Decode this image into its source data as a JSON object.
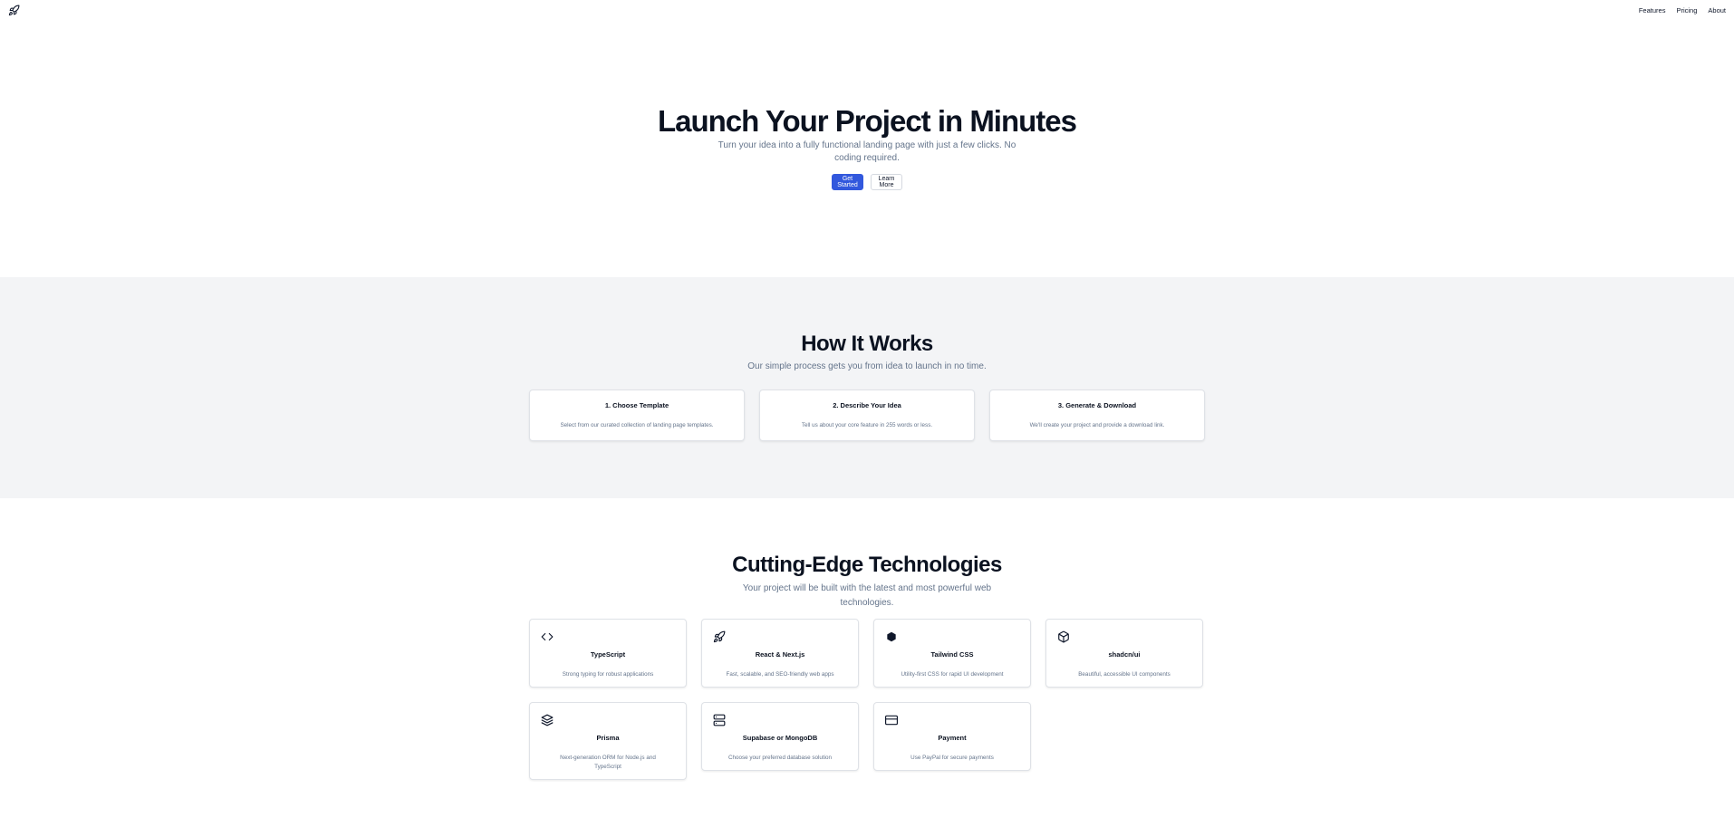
{
  "header": {
    "logo_icon": "rocket-icon",
    "nav": [
      "Features",
      "Pricing",
      "About"
    ]
  },
  "hero": {
    "title": "Launch Your Project in Minutes",
    "subtitle": "Turn your idea into a fully functional landing page with just a few clicks. No coding required.",
    "primary_button": "Get Started",
    "secondary_button": "Learn More"
  },
  "how": {
    "title": "How It Works",
    "subtitle": "Our simple process gets you from idea to launch in no time.",
    "steps": [
      {
        "title": "1. Choose Template",
        "desc": "Select from our curated collection of landing page templates."
      },
      {
        "title": "2. Describe Your Idea",
        "desc": "Tell us about your core feature in 255 words or less."
      },
      {
        "title": "3. Generate & Download",
        "desc": "We'll create your project and provide a download link."
      }
    ]
  },
  "tech": {
    "title": "Cutting-Edge Technologies",
    "subtitle": "Your project will be built with the latest and most powerful web technologies.",
    "items": [
      {
        "icon": "code-icon",
        "title": "TypeScript",
        "desc": "Strong typing for robust applications"
      },
      {
        "icon": "rocket-icon",
        "title": "React & Next.js",
        "desc": "Fast, scalable, and SEO-friendly web apps"
      },
      {
        "icon": "hexagon-icon",
        "title": "Tailwind CSS",
        "desc": "Utility-first CSS for rapid UI development"
      },
      {
        "icon": "box-icon",
        "title": "shadcn/ui",
        "desc": "Beautiful, accessible UI components"
      },
      {
        "icon": "layers-icon",
        "title": "Prisma",
        "desc": "Next-generation ORM for Node.js and TypeScript"
      },
      {
        "icon": "server-icon",
        "title": "Supabase or MongoDB",
        "desc": "Choose your preferred database solution"
      },
      {
        "icon": "credit-card-icon",
        "title": "Payment",
        "desc": "Use PayPal for secure payments"
      }
    ]
  },
  "colors": {
    "primary": "#3258dd",
    "muted_text": "#64748b",
    "section_bg": "#f3f4f6"
  }
}
